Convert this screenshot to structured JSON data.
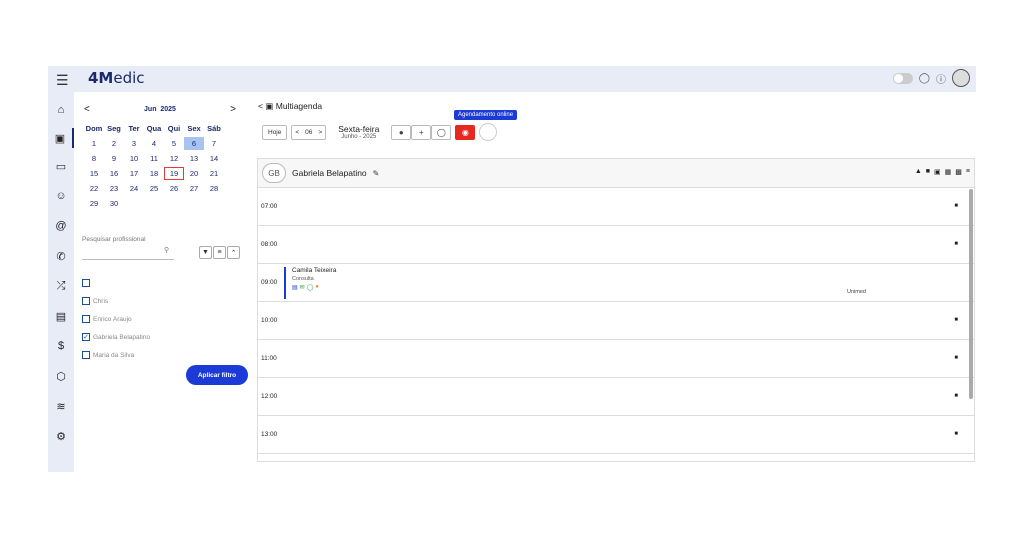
{
  "brand": {
    "logo_bold": "4M",
    "logo_rest": "edic"
  },
  "topbar": {
    "icons": [
      "toggle-switch",
      "chat-icon",
      "help-icon",
      "user-avatar-icon"
    ]
  },
  "sidenav": {
    "items": [
      "home-icon",
      "calendar-icon",
      "inbox-icon",
      "user-icon",
      "at-icon",
      "phone-icon",
      "shuffle-icon",
      "clipboard-icon",
      "dollar-icon",
      "box-icon",
      "chart-icon",
      "gear-icon"
    ]
  },
  "calendar": {
    "prev": "<",
    "month": "Jun",
    "year": "2025",
    "next": ">",
    "weekdays": [
      "Dom",
      "Seg",
      "Ter",
      "Qua",
      "Qui",
      "Sex",
      "Sáb"
    ],
    "days": [
      "1",
      "2",
      "3",
      "4",
      "5",
      "6",
      "7",
      "8",
      "9",
      "10",
      "11",
      "12",
      "13",
      "14",
      "15",
      "16",
      "17",
      "18",
      "19",
      "20",
      "21",
      "22",
      "23",
      "24",
      "25",
      "26",
      "27",
      "28",
      "29",
      "30"
    ],
    "selected_day": "6",
    "today_day": "19"
  },
  "filter": {
    "search_label": "Pesquisar profissional",
    "professionals": [
      {
        "name": "",
        "checked": false
      },
      {
        "name": "Chris",
        "checked": false
      },
      {
        "name": "Enrico Araujo",
        "checked": false
      },
      {
        "name": "Gabriela Belapatino",
        "checked": true
      },
      {
        "name": "Maria da Silva",
        "checked": false
      }
    ],
    "apply_label": "Aplicar filtro"
  },
  "agenda": {
    "title": "Multiagenda",
    "today_label": "Hoje",
    "day_number": "06",
    "day_name": "Sexta-feira",
    "month_year": "Junho - 2025",
    "tooltip": "Agendamento online"
  },
  "schedule": {
    "professional_initials": "GB",
    "professional_name": "Gabriela Belapatino",
    "slots": [
      {
        "time": "07:00"
      },
      {
        "time": "08:00"
      },
      {
        "time": "09:00",
        "patient": "Camila Teixeira",
        "type": "Consulta",
        "insurance": "Unimed"
      },
      {
        "time": "10:00"
      },
      {
        "time": "11:00"
      },
      {
        "time": "12:00"
      },
      {
        "time": "13:00"
      }
    ]
  },
  "colors": {
    "accent": "#1c3ad6",
    "online_button": "#e8281e",
    "selected_day": "#a7c4f0",
    "nav_bg": "#e8ecf7"
  }
}
